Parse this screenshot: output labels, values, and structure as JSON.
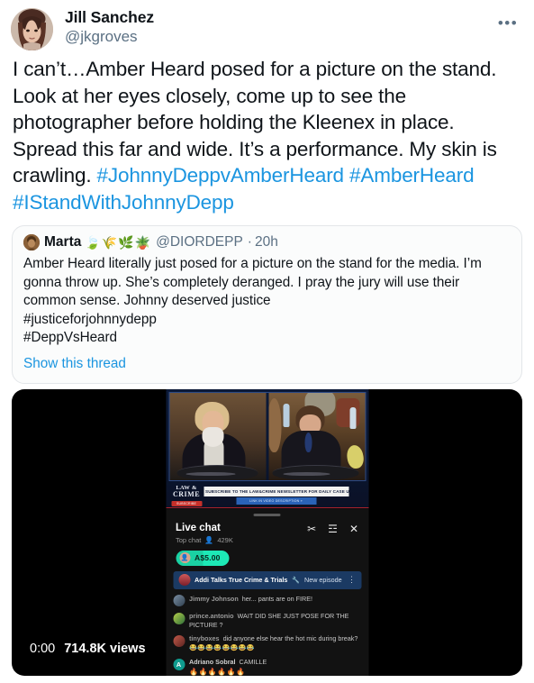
{
  "tweet": {
    "author": {
      "display_name": "Jill Sanchez",
      "handle": "@jkgroves",
      "avatar_name": "profile-photo-woman"
    },
    "more_menu_label": "•••",
    "body_segments": [
      {
        "type": "text",
        "value": "I can’t…Amber Heard posed for a picture on the stand. Look at her eyes closely, come up to see the photographer before holding the Kleenex in place. Spread this far and wide. It’s a performance. My skin is crawling. "
      },
      {
        "type": "hashtag",
        "value": "#JohnnyDeppvAmberHeard"
      },
      {
        "type": "text",
        "value": " "
      },
      {
        "type": "hashtag",
        "value": "#AmberHeard"
      },
      {
        "type": "text",
        "value": " "
      },
      {
        "type": "hashtag",
        "value": "#IStandWithJohnnyDepp"
      }
    ],
    "text_plain": "I can’t…Amber Heard posed for a picture on the stand. Look at her eyes closely, come up to see the photographer before holding the Kleenex in place. Spread this far and wide. It’s a performance. My skin is crawling.",
    "hashtags": [
      "#JohnnyDeppvAmberHeard",
      "#AmberHeard",
      "#IStandWithJohnnyDepp"
    ]
  },
  "quoted_tweet": {
    "author_name": "Marta",
    "author_emojis": "🍃🌾🌿🪴",
    "handle": "@DIORDEPP",
    "separator": "·",
    "timestamp": "20h",
    "body_line_1": "Amber Heard literally just posed for a picture on the stand for the media. I’m",
    "body_line_2": "gonna throw up. She’s completely deranged. I pray the jury will use their common",
    "body_line_3": "sense. Johnny deserved justice",
    "hashtag_1": "#justiceforjohnnydepp",
    "hashtag_2": "#DeppVsHeard",
    "show_thread_label": "Show this thread"
  },
  "video": {
    "current_time": "0:00",
    "view_count": "714.8K views",
    "broadcast": {
      "watermark_line1": "LAW &",
      "watermark_line2": "CRIME",
      "watermark_badge": "SUBSCRIBE",
      "newsletter_banner": "SUBSCRIBE TO THE LAW&CRIME NEWSLETTER FOR DAILY CASE UPDATES",
      "link_banner": "LINK IN VIDEO DESCRIPTION »"
    },
    "live_chat": {
      "title": "Live chat",
      "subtitle_label": "Top chat",
      "viewer_icon": "👤",
      "viewer_count": "429K",
      "icons": {
        "scissors": "✂",
        "settings": "☲",
        "close": "✕"
      },
      "superchat": {
        "amount": "A$5.00",
        "avatar_name": "superchat-avatar"
      },
      "pinned_message": {
        "author": "Addi Talks True Crime & Trials",
        "emoji": "🔧",
        "text": "New episode of...",
        "overflow_label": "⋮"
      },
      "messages": [
        {
          "author": "Jimmy Johnson",
          "text": "her... pants are on FIRE!",
          "emojis": "",
          "avatar_class": "ava-1",
          "avatar_letter": ""
        },
        {
          "author": "prince.antonio",
          "text": "WAIT DID SHE JUST POSE FOR THE PICTURE ?",
          "emojis": "",
          "avatar_class": "ava-2",
          "avatar_letter": ""
        },
        {
          "author": "tinyboxes",
          "text": "did anyone else hear the hot mic during break?",
          "emojis": "😂😂😂😂😂😂😂😂",
          "avatar_class": "ava-3",
          "avatar_letter": ""
        },
        {
          "author": "Adriano Sobral",
          "text": "CAMILLE",
          "emojis": "🔥🔥🔥🔥🔥🔥",
          "avatar_class": "ava-4",
          "avatar_letter": "A"
        }
      ]
    }
  },
  "colors": {
    "link_blue": "#1b95e0",
    "text_primary": "#0f1419",
    "text_secondary": "#5b7083",
    "card_border": "#e3e6e9",
    "superchat_green": "#1de9b6",
    "pinned_blue": "#1b3a63"
  }
}
